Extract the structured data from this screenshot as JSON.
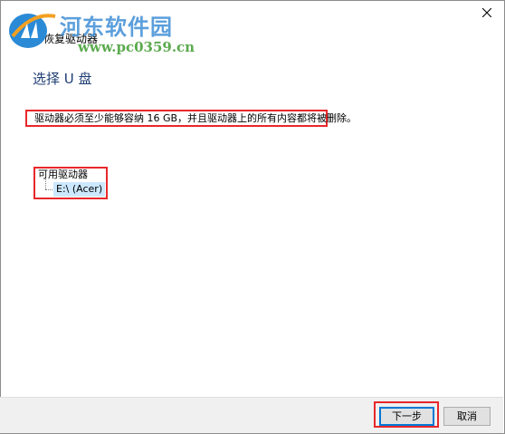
{
  "window": {
    "title": "恢复驱动器",
    "close_icon": "close-icon"
  },
  "watermark": {
    "site_name": "河东软件园",
    "url": "www.pc0359.cn"
  },
  "page": {
    "heading": "选择 U 盘",
    "notice": "驱动器必须至少能够容纳 16 GB，并且驱动器上的所有内容都将被删除。"
  },
  "drives": {
    "label": "可用驱动器",
    "items": [
      {
        "label": "E:\\ (Acer)",
        "selected": true
      }
    ]
  },
  "footer": {
    "next_label": "下一步",
    "cancel_label": "取消"
  },
  "colors": {
    "highlight_box": "#e8272a",
    "heading_text": "#1e3d73",
    "selection": "#cce8ff"
  }
}
